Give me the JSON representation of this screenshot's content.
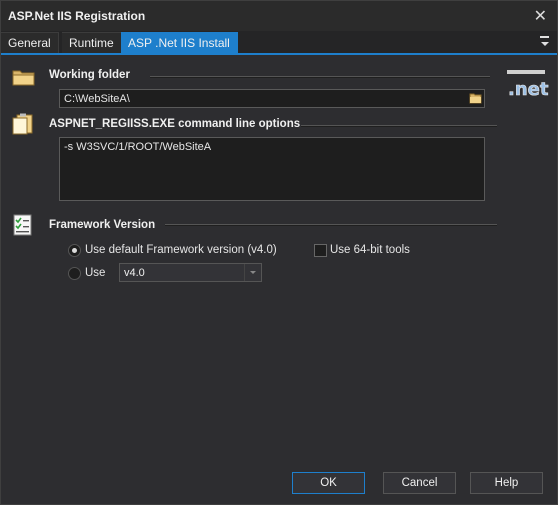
{
  "window": {
    "title": "ASP.Net IIS Registration",
    "close_glyph": "✕"
  },
  "tabs": [
    {
      "label": "General",
      "active": false
    },
    {
      "label": "Runtime",
      "active": false
    },
    {
      "label": "ASP .Net IIS Install",
      "active": true
    }
  ],
  "working_folder": {
    "title": "Working folder",
    "value": "C:\\WebSiteA\\",
    "icon": "folder-icon",
    "browse_icon": "folder-browse-icon"
  },
  "options": {
    "title": "ASPNET_REGIISS.EXE command line options",
    "value": "-s W3SVC/1/ROOT/WebSiteA",
    "icon": "clipboard-icon"
  },
  "framework": {
    "title": "Framework Version",
    "icon": "checklist-icon",
    "default_label": "Use default Framework version (v4.0)",
    "default_selected": true,
    "use_label": "Use",
    "use_selected": false,
    "version_value": "v4.0",
    "use64_label": "Use 64-bit tools",
    "use64_checked": false
  },
  "logo": {
    "name": "dotnet-logo"
  },
  "buttons": {
    "ok": "OK",
    "cancel": "Cancel",
    "help": "Help"
  },
  "colors": {
    "accent": "#1e7fcc",
    "background": "#2d2d30",
    "field": "#1e1e1e"
  }
}
